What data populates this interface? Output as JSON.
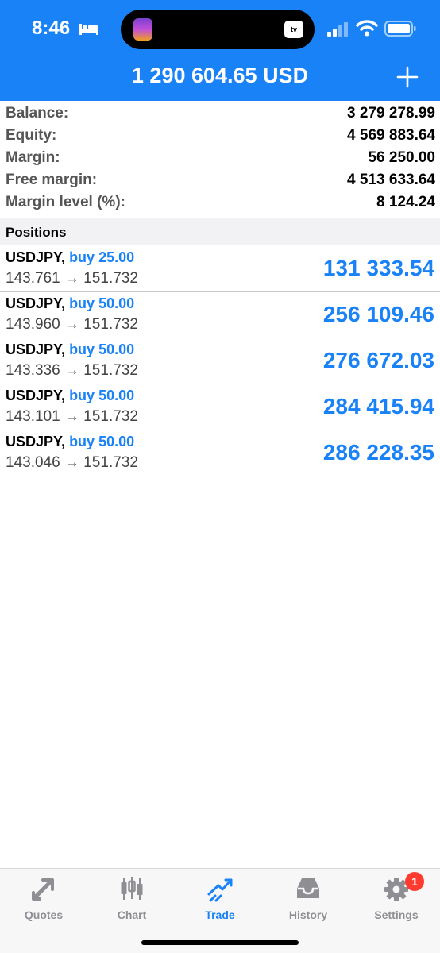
{
  "status_bar": {
    "time": "8:46",
    "tv_label": "tv"
  },
  "header": {
    "title": "1 290 604.65 USD"
  },
  "summary": [
    {
      "label": "Balance:",
      "value": "3 279 278.99"
    },
    {
      "label": "Equity:",
      "value": "4 569 883.64"
    },
    {
      "label": "Margin:",
      "value": "56 250.00"
    },
    {
      "label": "Free margin:",
      "value": "4 513 633.64"
    },
    {
      "label": "Margin level (%):",
      "value": "8 124.24"
    }
  ],
  "positions_header": "Positions",
  "positions": [
    {
      "symbol": "USDJPY,",
      "type": "buy 25.00",
      "prices": "143.761 → 151.732",
      "profit": "131 333.54"
    },
    {
      "symbol": "USDJPY,",
      "type": "buy 50.00",
      "prices": "143.960 → 151.732",
      "profit": "256 109.46"
    },
    {
      "symbol": "USDJPY,",
      "type": "buy 50.00",
      "prices": "143.336 → 151.732",
      "profit": "276 672.03"
    },
    {
      "symbol": "USDJPY,",
      "type": "buy 50.00",
      "prices": "143.101 → 151.732",
      "profit": "284 415.94"
    },
    {
      "symbol": "USDJPY,",
      "type": "buy 50.00",
      "prices": "143.046 → 151.732",
      "profit": "286 228.35"
    }
  ],
  "tabs": [
    {
      "label": "Quotes",
      "icon": "quotes-arrows-icon"
    },
    {
      "label": "Chart",
      "icon": "candlestick-icon"
    },
    {
      "label": "Trade",
      "icon": "trade-trend-icon",
      "active": true
    },
    {
      "label": "History",
      "icon": "inbox-icon"
    },
    {
      "label": "Settings",
      "icon": "gear-icon",
      "badge": "1"
    }
  ],
  "colors": {
    "accent": "#1a82f7",
    "badge": "#ff3b30",
    "inactive_tab": "#8e8e93"
  }
}
